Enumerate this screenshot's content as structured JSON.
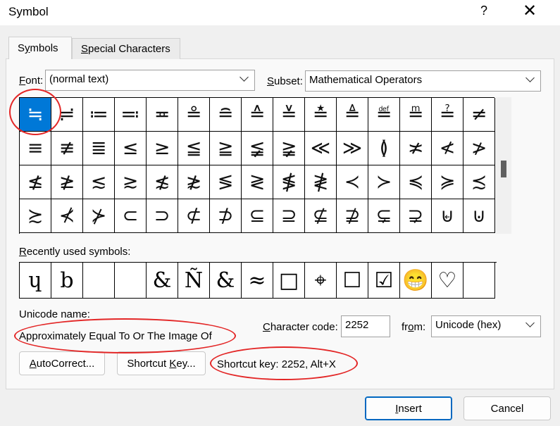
{
  "window": {
    "title": "Symbol",
    "help": "?",
    "close": "✕"
  },
  "tabs": [
    {
      "label": "Symbols",
      "selected": true
    },
    {
      "label": "Special Characters",
      "selected": false
    }
  ],
  "font": {
    "label": "Font:",
    "value": "(normal text)"
  },
  "subset": {
    "label": "Subset:",
    "value": "Mathematical Operators"
  },
  "grid": [
    [
      "≒",
      "≓",
      "≔",
      "≕",
      "≖",
      "≗",
      "≘",
      "≙",
      "≚",
      "≛",
      "≜",
      "≝",
      "≞",
      "≟",
      "≠"
    ],
    [
      "≡",
      "≢",
      "≣",
      "≤",
      "≥",
      "≦",
      "≧",
      "≨",
      "≩",
      "≪",
      "≫",
      "≬",
      "≭",
      "≮",
      "≯"
    ],
    [
      "≰",
      "≱",
      "≲",
      "≳",
      "≴",
      "≵",
      "≶",
      "≷",
      "≸",
      "≹",
      "≺",
      "≻",
      "≼",
      "≽",
      "≾"
    ],
    [
      "≿",
      "⊀",
      "⊁",
      "⊂",
      "⊃",
      "⊄",
      "⊅",
      "⊆",
      "⊇",
      "⊈",
      "⊉",
      "⊊",
      "⊋",
      "⊌",
      "⊍"
    ]
  ],
  "recent": {
    "label": "Recently used symbols:",
    "items": [
      "ɥ",
      "b",
      "",
      "",
      "&",
      "Ñ",
      "&",
      "≈",
      "□",
      "⌖",
      "☐",
      "☑",
      "😁",
      "♡",
      ""
    ]
  },
  "unicode_name": {
    "label": "Unicode name:",
    "value": "Approximately Equal To Or The Image Of"
  },
  "char_code": {
    "label": "Character code:",
    "value": "2252"
  },
  "from": {
    "label": "from:",
    "value": "Unicode (hex)"
  },
  "buttons": {
    "autocorrect": "AutoCorrect...",
    "shortcut_key": "Shortcut Key...",
    "insert": "Insert",
    "cancel": "Cancel"
  },
  "shortcut_text": "Shortcut key: 2252, Alt+X",
  "colors": {
    "selection": "#0078d7",
    "annotation": "#e32626"
  }
}
